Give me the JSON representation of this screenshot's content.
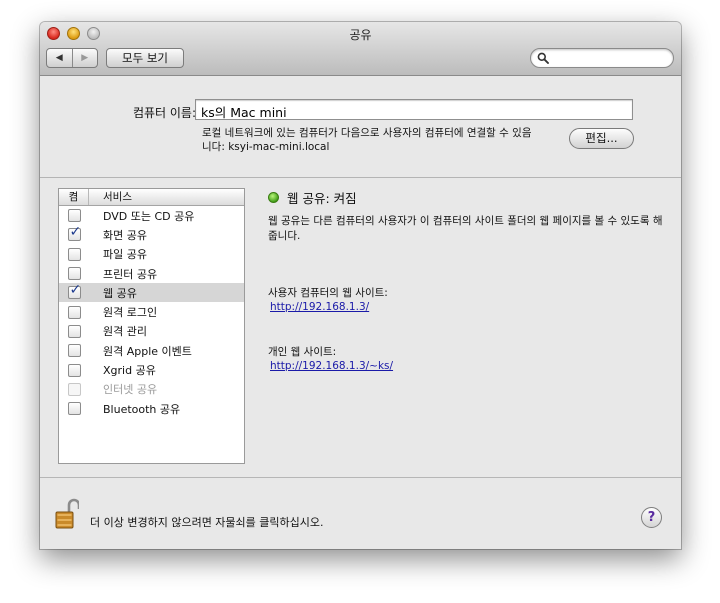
{
  "window": {
    "title": "공유"
  },
  "toolbar": {
    "back_label": "◀",
    "forward_label": "▶",
    "show_all_label": "모두 보기",
    "search_placeholder": ""
  },
  "computer": {
    "name_label": "컴퓨터 이름:",
    "name_value": "ks의 Mac mini",
    "description_line1": "로컬 네트워크에 있는 컴퓨터가 다음으로 사용자의 컴퓨터에 연결할 수 있음",
    "description_line2": "니다: ksyi-mac-mini.local",
    "edit_label": "편집..."
  },
  "services": {
    "header_on": "켬",
    "header_service": "서비스",
    "items": [
      {
        "label": "DVD 또는 CD 공유",
        "checked": false,
        "selected": false,
        "disabled": false
      },
      {
        "label": "화면 공유",
        "checked": true,
        "selected": false,
        "disabled": false
      },
      {
        "label": "파일 공유",
        "checked": false,
        "selected": false,
        "disabled": false
      },
      {
        "label": "프린터 공유",
        "checked": false,
        "selected": false,
        "disabled": false
      },
      {
        "label": "웹 공유",
        "checked": true,
        "selected": true,
        "disabled": false
      },
      {
        "label": "원격 로그인",
        "checked": false,
        "selected": false,
        "disabled": false
      },
      {
        "label": "원격 관리",
        "checked": false,
        "selected": false,
        "disabled": false
      },
      {
        "label": "원격 Apple 이벤트",
        "checked": false,
        "selected": false,
        "disabled": false
      },
      {
        "label": "Xgrid 공유",
        "checked": false,
        "selected": false,
        "disabled": false
      },
      {
        "label": "인터넷 공유",
        "checked": false,
        "selected": false,
        "disabled": true
      },
      {
        "label": "Bluetooth 공유",
        "checked": false,
        "selected": false,
        "disabled": false
      }
    ]
  },
  "detail": {
    "status": "웹 공유: 켜짐",
    "status_color": "#3c9a14",
    "description": "웹 공유는 다른 컴퓨터의 사용자가 이 컴퓨터의 사이트 폴더의 웹 페이지를 볼 수 있도록 해줍니다.",
    "computer_site_label": "사용자 컴퓨터의 웹 사이트:",
    "computer_site_url": "http://192.168.1.3/",
    "personal_site_label": "개인 웹 사이트:",
    "personal_site_url": "http://192.168.1.3/~ks/"
  },
  "footer": {
    "lock_text": "더 이상 변경하지 않으려면 자물쇠를 클릭하십시오.",
    "help_label": "?"
  }
}
